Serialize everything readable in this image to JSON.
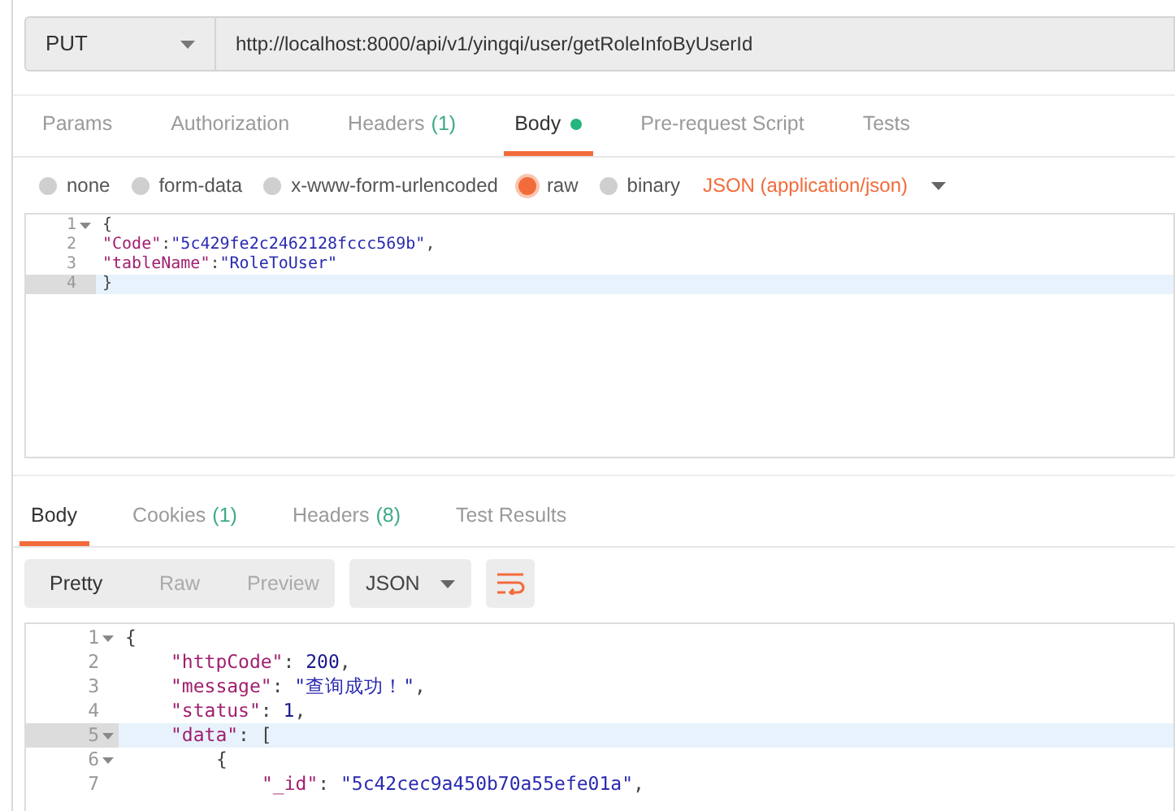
{
  "request": {
    "method": "PUT",
    "url": "http://localhost:8000/api/v1/yingqi/user/getRoleInfoByUserId"
  },
  "request_tabs": [
    {
      "label": "Params",
      "selected": false
    },
    {
      "label": "Authorization",
      "selected": false
    },
    {
      "label": "Headers",
      "count": "(1)",
      "selected": false
    },
    {
      "label": "Body",
      "dot": true,
      "selected": true
    },
    {
      "label": "Pre-request Script",
      "selected": false
    },
    {
      "label": "Tests",
      "selected": false
    }
  ],
  "body_types": [
    {
      "label": "none",
      "selected": false
    },
    {
      "label": "form-data",
      "selected": false
    },
    {
      "label": "x-www-form-urlencoded",
      "selected": false
    },
    {
      "label": "raw",
      "selected": true
    },
    {
      "label": "binary",
      "selected": false
    }
  ],
  "format_dropdown": "JSON (application/json)",
  "request_editor": [
    {
      "number": "1",
      "fold": true,
      "current": false,
      "tokens": [
        {
          "kind": "punct",
          "text": "{"
        }
      ]
    },
    {
      "number": "2",
      "fold": false,
      "current": false,
      "tokens": [
        {
          "kind": "key",
          "text": "\"Code\""
        },
        {
          "kind": "punct",
          "text": ":"
        },
        {
          "kind": "string",
          "text": "\"5c429fe2c2462128fccc569b\""
        },
        {
          "kind": "punct",
          "text": ","
        }
      ]
    },
    {
      "number": "3",
      "fold": false,
      "current": false,
      "tokens": [
        {
          "kind": "key",
          "text": "\"tableName\""
        },
        {
          "kind": "punct",
          "text": ":"
        },
        {
          "kind": "string",
          "text": "\"RoleToUser\""
        }
      ]
    },
    {
      "number": "4",
      "fold": false,
      "current": true,
      "tokens": [
        {
          "kind": "punct",
          "text": "}"
        }
      ]
    }
  ],
  "response_tabs": [
    {
      "label": "Body",
      "selected": true
    },
    {
      "label": "Cookies",
      "count": "(1)",
      "selected": false
    },
    {
      "label": "Headers",
      "count": "(8)",
      "selected": false
    },
    {
      "label": "Test Results",
      "selected": false
    }
  ],
  "view_modes": [
    {
      "label": "Pretty",
      "selected": true
    },
    {
      "label": "Raw",
      "selected": false
    },
    {
      "label": "Preview",
      "selected": false
    }
  ],
  "response_format": "JSON",
  "response_editor": [
    {
      "number": "1",
      "fold": true,
      "current": false,
      "tokens": [
        {
          "kind": "punct",
          "text": "{"
        }
      ],
      "children": [
        {
          "number": "2",
          "fold": false,
          "current": false,
          "tokens": [
            {
              "kind": "key",
              "text": "\"httpCode\""
            },
            {
              "kind": "punct",
              "text": ": "
            },
            {
              "kind": "number",
              "text": "200"
            },
            {
              "kind": "punct",
              "text": ","
            }
          ]
        },
        {
          "number": "3",
          "fold": false,
          "current": false,
          "tokens": [
            {
              "kind": "key",
              "text": "\"message\""
            },
            {
              "kind": "punct",
              "text": ": "
            },
            {
              "kind": "string",
              "text": "\"查询成功！\""
            },
            {
              "kind": "punct",
              "text": ","
            }
          ]
        },
        {
          "number": "4",
          "fold": false,
          "current": false,
          "tokens": [
            {
              "kind": "key",
              "text": "\"status\""
            },
            {
              "kind": "punct",
              "text": ": "
            },
            {
              "kind": "number",
              "text": "1"
            },
            {
              "kind": "punct",
              "text": ","
            }
          ]
        },
        {
          "number": "5",
          "fold": true,
          "current": true,
          "tokens": [
            {
              "kind": "key",
              "text": "\"data\""
            },
            {
              "kind": "punct",
              "text": ": ["
            }
          ],
          "children": [
            {
              "number": "6",
              "fold": true,
              "current": false,
              "tokens": [
                {
                  "kind": "punct",
                  "text": "{"
                }
              ],
              "children": [
                {
                  "number": "7",
                  "fold": false,
                  "current": false,
                  "tokens": [
                    {
                      "kind": "key",
                      "text": "\"_id\""
                    },
                    {
                      "kind": "punct",
                      "text": ": "
                    },
                    {
                      "kind": "string",
                      "text": "\"5c42cec9a450b70a55efe01a\""
                    },
                    {
                      "kind": "punct",
                      "text": ","
                    }
                  ]
                }
              ]
            }
          ]
        }
      ]
    }
  ]
}
